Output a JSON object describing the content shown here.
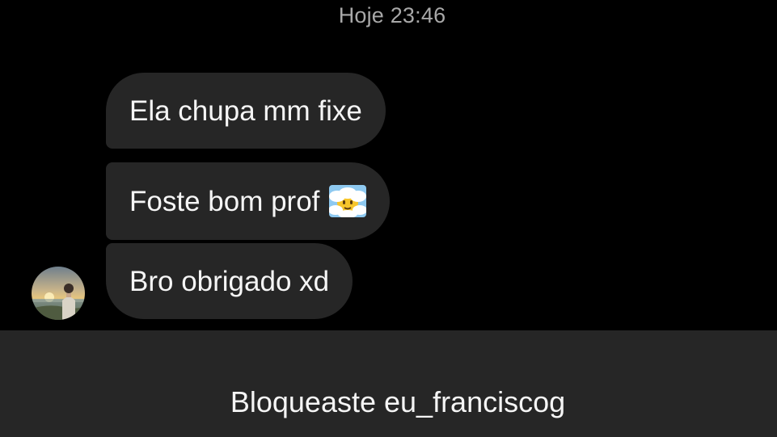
{
  "chat": {
    "timestamp": "Hoje 23:46",
    "messages": [
      {
        "text": "Ela chupa mm fixe"
      },
      {
        "text": "Foste bom prof",
        "emoji": "face-in-clouds-emoji"
      },
      {
        "text": "Bro obrigado xd"
      }
    ],
    "avatar_icon": "user-avatar-photo"
  },
  "footer": {
    "blocked_text": "Bloqueaste eu_franciscog"
  },
  "colors": {
    "background": "#000000",
    "bubble": "#262626",
    "text": "#f5f5f5",
    "timestamp": "#a8a8a8",
    "footer": "#262626"
  }
}
